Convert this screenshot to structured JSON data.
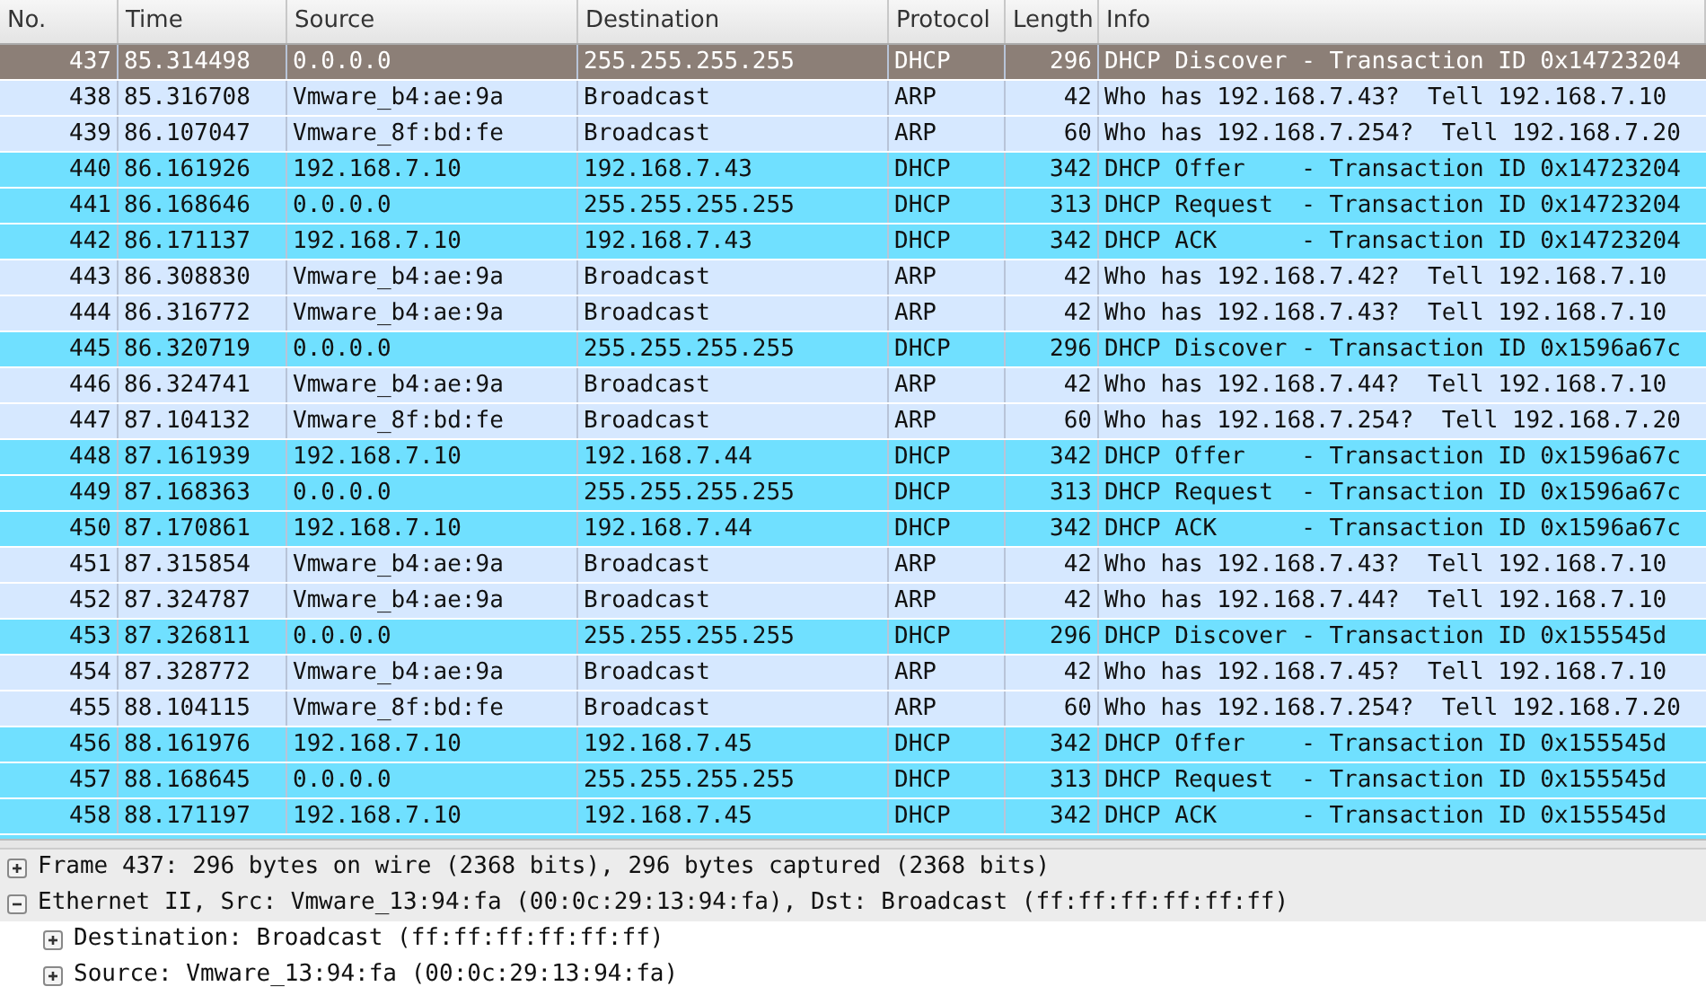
{
  "packet_list": {
    "columns": [
      "No.",
      "Time",
      "Source",
      "Destination",
      "Protocol",
      "Length",
      "Info"
    ],
    "rows": [
      {
        "no": "437",
        "time": "85.314498",
        "source": "0.0.0.0",
        "destination": "255.255.255.255",
        "protocol": "DHCP",
        "length": "296",
        "info": "DHCP Discover - Transaction ID 0x14723204",
        "selected": true
      },
      {
        "no": "438",
        "time": "85.316708",
        "source": "Vmware_b4:ae:9a",
        "destination": "Broadcast",
        "protocol": "ARP",
        "length": "42",
        "info": "Who has 192.168.7.43?  Tell 192.168.7.10",
        "kind": "arp",
        "selected": false
      },
      {
        "no": "439",
        "time": "86.107047",
        "source": "Vmware_8f:bd:fe",
        "destination": "Broadcast",
        "protocol": "ARP",
        "length": "60",
        "info": "Who has 192.168.7.254?  Tell 192.168.7.20",
        "kind": "arp",
        "selected": false
      },
      {
        "no": "440",
        "time": "86.161926",
        "source": "192.168.7.10",
        "destination": "192.168.7.43",
        "protocol": "DHCP",
        "length": "342",
        "info": "DHCP Offer    - Transaction ID 0x14723204",
        "kind": "udp",
        "selected": false
      },
      {
        "no": "441",
        "time": "86.168646",
        "source": "0.0.0.0",
        "destination": "255.255.255.255",
        "protocol": "DHCP",
        "length": "313",
        "info": "DHCP Request  - Transaction ID 0x14723204",
        "kind": "udp",
        "selected": false
      },
      {
        "no": "442",
        "time": "86.171137",
        "source": "192.168.7.10",
        "destination": "192.168.7.43",
        "protocol": "DHCP",
        "length": "342",
        "info": "DHCP ACK      - Transaction ID 0x14723204",
        "kind": "udp",
        "selected": false
      },
      {
        "no": "443",
        "time": "86.308830",
        "source": "Vmware_b4:ae:9a",
        "destination": "Broadcast",
        "protocol": "ARP",
        "length": "42",
        "info": "Who has 192.168.7.42?  Tell 192.168.7.10",
        "kind": "arp",
        "selected": false
      },
      {
        "no": "444",
        "time": "86.316772",
        "source": "Vmware_b4:ae:9a",
        "destination": "Broadcast",
        "protocol": "ARP",
        "length": "42",
        "info": "Who has 192.168.7.43?  Tell 192.168.7.10",
        "kind": "arp",
        "selected": false
      },
      {
        "no": "445",
        "time": "86.320719",
        "source": "0.0.0.0",
        "destination": "255.255.255.255",
        "protocol": "DHCP",
        "length": "296",
        "info": "DHCP Discover - Transaction ID 0x1596a67c",
        "kind": "udp",
        "selected": false
      },
      {
        "no": "446",
        "time": "86.324741",
        "source": "Vmware_b4:ae:9a",
        "destination": "Broadcast",
        "protocol": "ARP",
        "length": "42",
        "info": "Who has 192.168.7.44?  Tell 192.168.7.10",
        "kind": "arp",
        "selected": false
      },
      {
        "no": "447",
        "time": "87.104132",
        "source": "Vmware_8f:bd:fe",
        "destination": "Broadcast",
        "protocol": "ARP",
        "length": "60",
        "info": "Who has 192.168.7.254?  Tell 192.168.7.20",
        "kind": "arp",
        "selected": false
      },
      {
        "no": "448",
        "time": "87.161939",
        "source": "192.168.7.10",
        "destination": "192.168.7.44",
        "protocol": "DHCP",
        "length": "342",
        "info": "DHCP Offer    - Transaction ID 0x1596a67c",
        "kind": "udp",
        "selected": false
      },
      {
        "no": "449",
        "time": "87.168363",
        "source": "0.0.0.0",
        "destination": "255.255.255.255",
        "protocol": "DHCP",
        "length": "313",
        "info": "DHCP Request  - Transaction ID 0x1596a67c",
        "kind": "udp",
        "selected": false
      },
      {
        "no": "450",
        "time": "87.170861",
        "source": "192.168.7.10",
        "destination": "192.168.7.44",
        "protocol": "DHCP",
        "length": "342",
        "info": "DHCP ACK      - Transaction ID 0x1596a67c",
        "kind": "udp",
        "selected": false
      },
      {
        "no": "451",
        "time": "87.315854",
        "source": "Vmware_b4:ae:9a",
        "destination": "Broadcast",
        "protocol": "ARP",
        "length": "42",
        "info": "Who has 192.168.7.43?  Tell 192.168.7.10",
        "kind": "arp",
        "selected": false
      },
      {
        "no": "452",
        "time": "87.324787",
        "source": "Vmware_b4:ae:9a",
        "destination": "Broadcast",
        "protocol": "ARP",
        "length": "42",
        "info": "Who has 192.168.7.44?  Tell 192.168.7.10",
        "kind": "arp",
        "selected": false
      },
      {
        "no": "453",
        "time": "87.326811",
        "source": "0.0.0.0",
        "destination": "255.255.255.255",
        "protocol": "DHCP",
        "length": "296",
        "info": "DHCP Discover - Transaction ID 0x155545d",
        "kind": "udp",
        "selected": false
      },
      {
        "no": "454",
        "time": "87.328772",
        "source": "Vmware_b4:ae:9a",
        "destination": "Broadcast",
        "protocol": "ARP",
        "length": "42",
        "info": "Who has 192.168.7.45?  Tell 192.168.7.10",
        "kind": "arp",
        "selected": false
      },
      {
        "no": "455",
        "time": "88.104115",
        "source": "Vmware_8f:bd:fe",
        "destination": "Broadcast",
        "protocol": "ARP",
        "length": "60",
        "info": "Who has 192.168.7.254?  Tell 192.168.7.20",
        "kind": "arp",
        "selected": false
      },
      {
        "no": "456",
        "time": "88.161976",
        "source": "192.168.7.10",
        "destination": "192.168.7.45",
        "protocol": "DHCP",
        "length": "342",
        "info": "DHCP Offer    - Transaction ID 0x155545d",
        "kind": "udp",
        "selected": false
      },
      {
        "no": "457",
        "time": "88.168645",
        "source": "0.0.0.0",
        "destination": "255.255.255.255",
        "protocol": "DHCP",
        "length": "313",
        "info": "DHCP Request  - Transaction ID 0x155545d",
        "kind": "udp",
        "selected": false
      },
      {
        "no": "458",
        "time": "88.171197",
        "source": "192.168.7.10",
        "destination": "192.168.7.45",
        "protocol": "DHCP",
        "length": "342",
        "info": "DHCP ACK      - Transaction ID 0x155545d",
        "kind": "udp",
        "selected": false
      }
    ]
  },
  "packet_details": [
    {
      "label": "Frame 437: 296 bytes on wire (2368 bits), 296 bytes captured (2368 bits)",
      "expanded": false
    },
    {
      "label": "Ethernet II, Src: Vmware_13:94:fa (00:0c:29:13:94:fa), Dst: Broadcast (ff:ff:ff:ff:ff:ff)",
      "expanded": true,
      "children": [
        {
          "label": "Destination: Broadcast (ff:ff:ff:ff:ff:ff)",
          "expanded": false
        },
        {
          "label": "Source: Vmware_13:94:fa (00:0c:29:13:94:fa)",
          "expanded": false
        }
      ]
    }
  ]
}
